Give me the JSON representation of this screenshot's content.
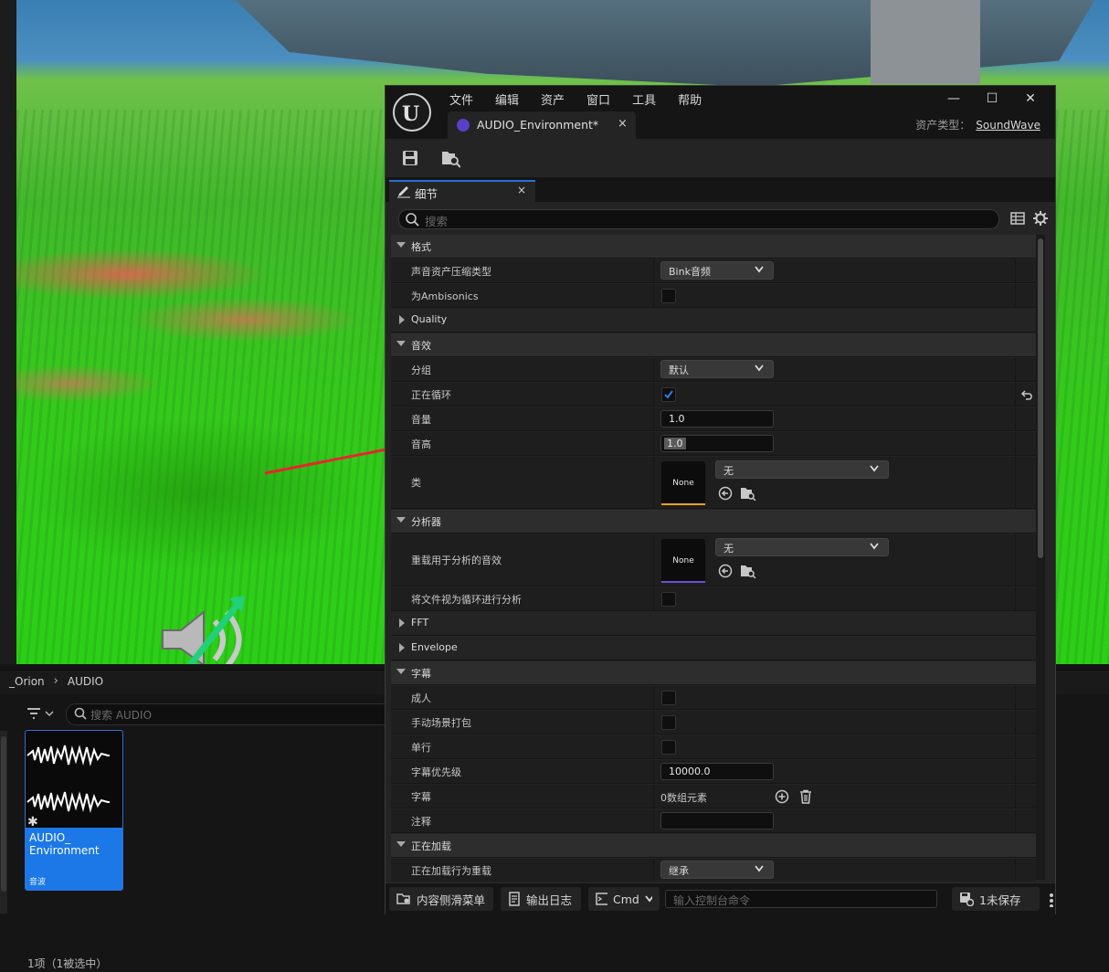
{
  "content_browser": {
    "breadcrumb": [
      "_Orion",
      "AUDIO"
    ],
    "search_placeholder": "搜索 AUDIO",
    "asset": {
      "name": "AUDIO_ Environment",
      "type": "音波"
    },
    "status": "1项（1被选中）"
  },
  "editor": {
    "menu": [
      "文件",
      "编辑",
      "资产",
      "窗口",
      "工具",
      "帮助"
    ],
    "doc_tab": "AUDIO_Environment*",
    "asset_type_label": "资产类型：",
    "asset_type_value": "SoundWave",
    "panel_tab": "细节",
    "search_placeholder": "搜索",
    "properties": {
      "format": "格式",
      "compression_type": {
        "label": "声音资产压缩类型",
        "value": "Bink音频"
      },
      "ambisonics": {
        "label": "为Ambisonics",
        "checked": false
      },
      "quality": "Quality",
      "sound": "音效",
      "group": {
        "label": "分组",
        "value": "默认"
      },
      "looping": {
        "label": "正在循环",
        "checked": true
      },
      "volume": {
        "label": "音量",
        "value": "1.0"
      },
      "pitch": {
        "label": "音高",
        "value": "1.0"
      },
      "class": {
        "label": "类",
        "thumb": "None",
        "value": "无"
      },
      "analysis": "分析器",
      "analysis_override": {
        "label": "重载用于分析的音效",
        "thumb": "None",
        "value": "无"
      },
      "treat_looping": {
        "label": "将文件视为循环进行分析",
        "checked": false
      },
      "fft": "FFT",
      "envelope": "Envelope",
      "subtitles": "字幕",
      "mature": {
        "label": "成人",
        "checked": false
      },
      "manual_word_wrap": {
        "label": "手动场景打包",
        "checked": false
      },
      "single_line": {
        "label": "单行",
        "checked": false
      },
      "subtitle_priority": {
        "label": "字幕优先级",
        "value": "10000.0"
      },
      "subtitles_array": {
        "label": "字幕",
        "value": "0数组元素"
      },
      "comment": {
        "label": "注释",
        "value": ""
      },
      "loading": "正在加载",
      "loading_override": {
        "label": "正在加载行为重载",
        "value": "继承"
      }
    },
    "bottom_bar": {
      "content_drawer": "内容侧滑菜单",
      "output_log": "输出日志",
      "cmd": "Cmd",
      "cmd_placeholder": "输入控制台命令",
      "unsaved": "1未保存"
    }
  },
  "colors": {
    "accent_blue": "#1b78e6",
    "class_thumb_bar": "#e6a11b",
    "override_thumb_bar": "#6f4fd6",
    "annotation_arrow": "#e8252d",
    "check": "#2b7be6"
  }
}
